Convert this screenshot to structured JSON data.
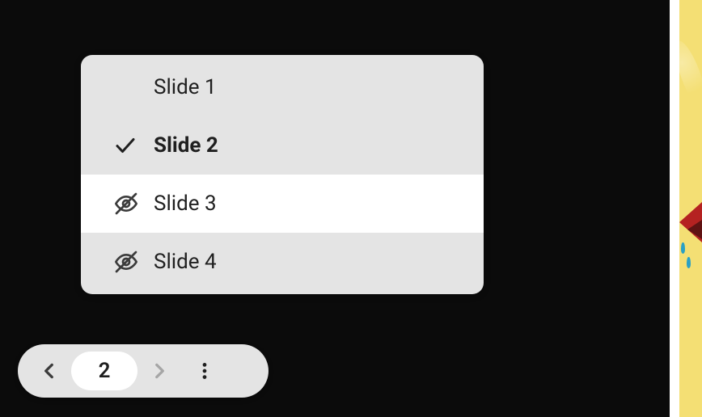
{
  "slides": [
    {
      "label": "Slide 1",
      "icon": "none",
      "current": false,
      "hovered": false
    },
    {
      "label": "Slide 2",
      "icon": "check",
      "current": true,
      "hovered": false
    },
    {
      "label": "Slide 3",
      "icon": "hidden",
      "current": false,
      "hovered": true
    },
    {
      "label": "Slide 4",
      "icon": "hidden",
      "current": false,
      "hovered": false
    }
  ],
  "nav": {
    "current_slide_number": "2",
    "prev_enabled": true,
    "next_enabled": false
  }
}
